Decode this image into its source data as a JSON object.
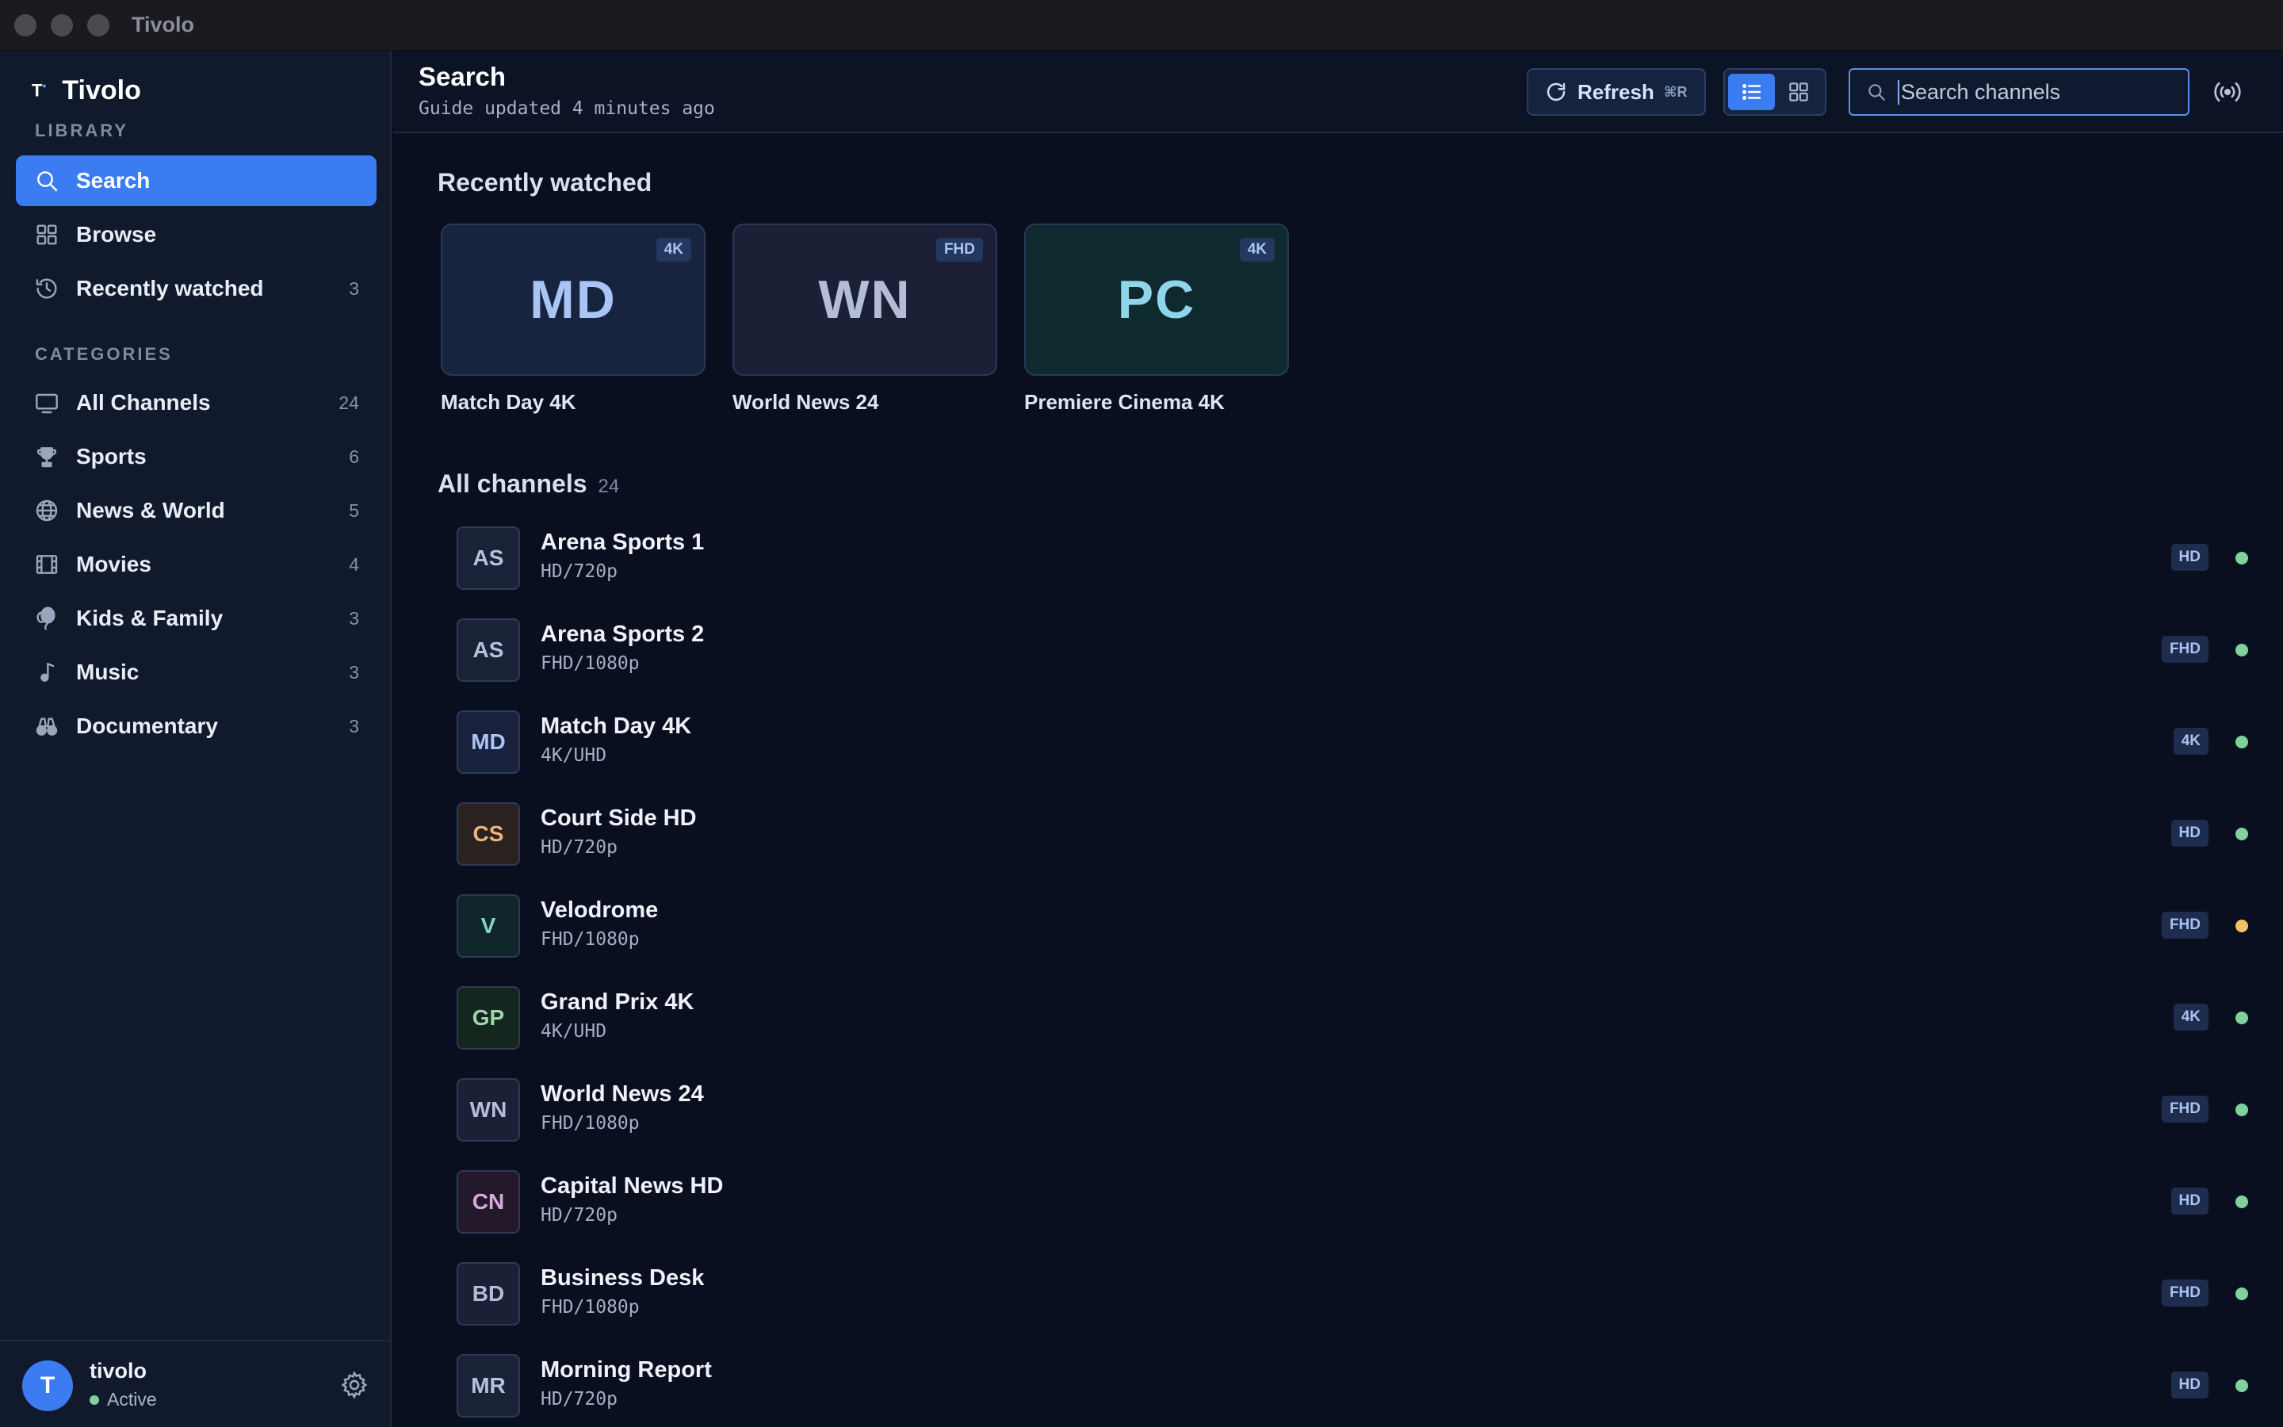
{
  "window": {
    "title": "Tivolo"
  },
  "sidebar": {
    "brand": "Tivolo",
    "library_label": "LIBRARY",
    "library": [
      {
        "label": "Search",
        "icon": "search-icon",
        "count": ""
      },
      {
        "label": "Browse",
        "icon": "grid-icon",
        "count": ""
      },
      {
        "label": "Recently watched",
        "icon": "history-icon",
        "count": "3"
      }
    ],
    "categories_label": "CATEGORIES",
    "categories": [
      {
        "label": "All Channels",
        "icon": "tv-icon",
        "count": "24"
      },
      {
        "label": "Sports",
        "icon": "trophy-icon",
        "count": "6"
      },
      {
        "label": "News & World",
        "icon": "globe-icon",
        "count": "5"
      },
      {
        "label": "Movies",
        "icon": "film-icon",
        "count": "4"
      },
      {
        "label": "Kids & Family",
        "icon": "balloon-icon",
        "count": "3"
      },
      {
        "label": "Music",
        "icon": "music-note-icon",
        "count": "3"
      },
      {
        "label": "Documentary",
        "icon": "binoculars-icon",
        "count": "3"
      }
    ],
    "user": {
      "initial": "T",
      "name": "tivolo",
      "status": "Active"
    }
  },
  "header": {
    "title": "Search",
    "subtitle": "Guide updated 4 minutes ago",
    "refresh_label": "Refresh",
    "refresh_shortcut": "⌘R",
    "search_placeholder": "Search channels"
  },
  "recent": {
    "title": "Recently watched",
    "items": [
      {
        "abbr": "MD",
        "badge": "4K",
        "name": "Match Day 4K",
        "bg": "#17233f",
        "fg": "#a9c4f5"
      },
      {
        "abbr": "WN",
        "badge": "FHD",
        "name": "World News 24",
        "bg": "#1b2036",
        "fg": "#b4bdd6"
      },
      {
        "abbr": "PC",
        "badge": "4K",
        "name": "Premiere Cinema 4K",
        "bg": "#0f2a2e",
        "fg": "#8fd6ea"
      }
    ]
  },
  "channels": {
    "title": "All channels",
    "count": "24",
    "items": [
      {
        "abbr": "AS",
        "name": "Arena Sports 1",
        "res": "HD/720p",
        "badge": "HD",
        "status": "online",
        "bg": "#1a2238",
        "fg": "#b6c2dc"
      },
      {
        "abbr": "AS",
        "name": "Arena Sports 2",
        "res": "FHD/1080p",
        "badge": "FHD",
        "status": "online",
        "bg": "#1a2238",
        "fg": "#b6c2dc"
      },
      {
        "abbr": "MD",
        "name": "Match Day 4K",
        "res": "4K/UHD",
        "badge": "4K",
        "status": "online",
        "bg": "#18223d",
        "fg": "#a9c4f5"
      },
      {
        "abbr": "CS",
        "name": "Court Side HD",
        "res": "HD/720p",
        "badge": "HD",
        "status": "online",
        "bg": "#2a2220",
        "fg": "#f0b27a"
      },
      {
        "abbr": "V",
        "name": "Velodrome",
        "res": "FHD/1080p",
        "badge": "FHD",
        "status": "warning",
        "bg": "#11262a",
        "fg": "#7fd3d3"
      },
      {
        "abbr": "GP",
        "name": "Grand Prix 4K",
        "res": "4K/UHD",
        "badge": "4K",
        "status": "online",
        "bg": "#14261e",
        "fg": "#9ed4a9"
      },
      {
        "abbr": "WN",
        "name": "World News 24",
        "res": "FHD/1080p",
        "badge": "FHD",
        "status": "online",
        "bg": "#1b2036",
        "fg": "#b4bdd6"
      },
      {
        "abbr": "CN",
        "name": "Capital News HD",
        "res": "HD/720p",
        "badge": "HD",
        "status": "online",
        "bg": "#24192b",
        "fg": "#d6a9e0"
      },
      {
        "abbr": "BD",
        "name": "Business Desk",
        "res": "FHD/1080p",
        "badge": "FHD",
        "status": "online",
        "bg": "#1b2036",
        "fg": "#b4bdd6"
      },
      {
        "abbr": "MR",
        "name": "Morning Report",
        "res": "HD/720p",
        "badge": "HD",
        "status": "online",
        "bg": "#1a2238",
        "fg": "#b6c2dc"
      }
    ]
  },
  "colors": {
    "accent": "#3b7cf2",
    "online": "#7fd39a",
    "warning": "#f3c066"
  }
}
